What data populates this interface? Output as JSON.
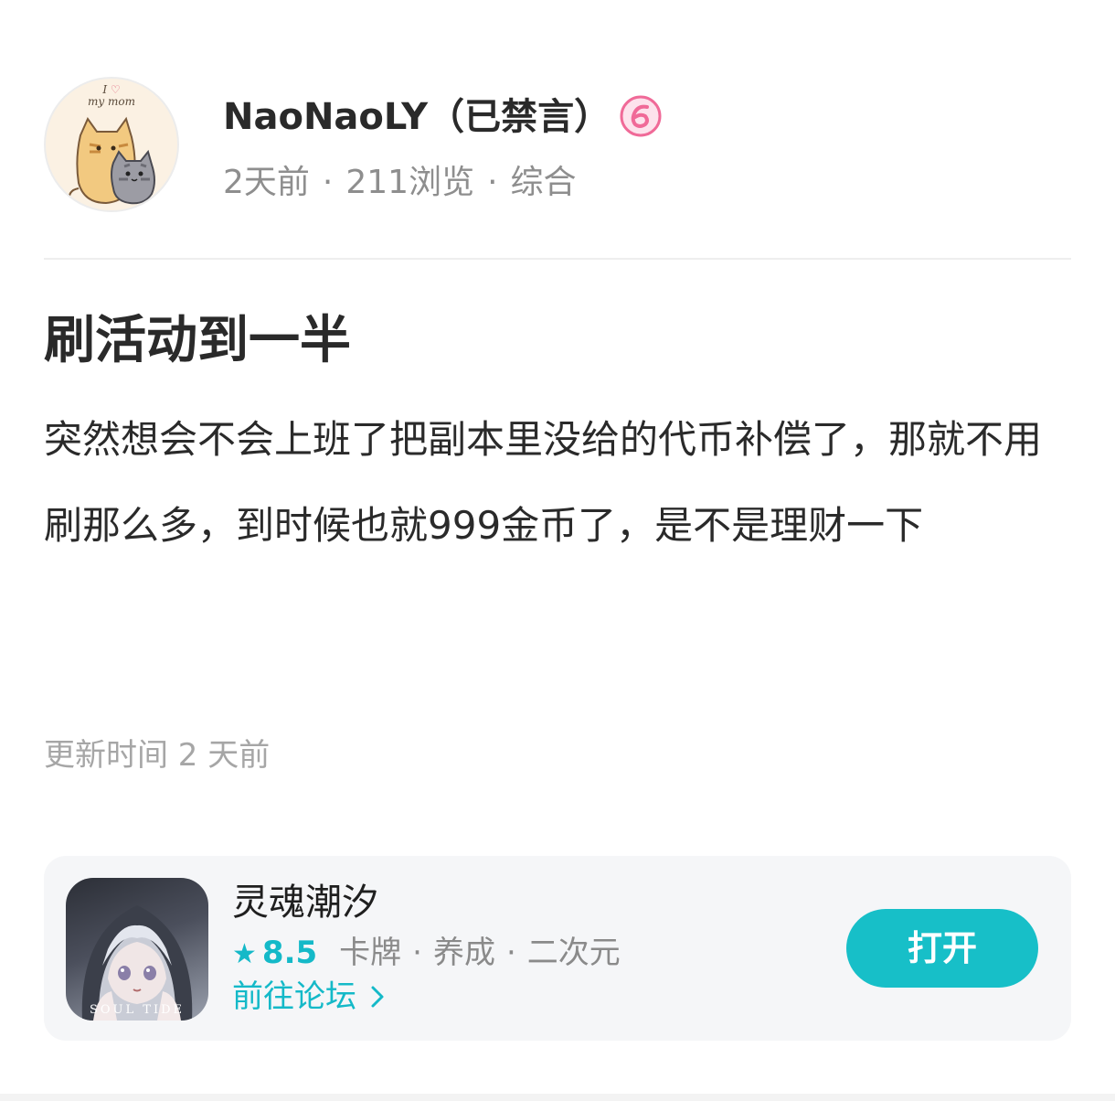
{
  "author": {
    "avatar_caption_top": "I",
    "avatar_caption_bottom": "my mom",
    "name": "NaoNaoLY（已禁言）",
    "level_icon": "level-6-badge-icon",
    "time": "2天前",
    "views": "211浏览",
    "category": "综合",
    "separator": "·"
  },
  "post": {
    "title": "刷活动到一半",
    "body": "突然想会不会上班了把副本里没给的代币补偿了，那就不用刷那么多，到时候也就999金币了，是不是理财一下",
    "updated": "更新时间 2 天前"
  },
  "app_card": {
    "name": "灵魂潮汐",
    "icon_text": "SOUL TIDE",
    "rating_icon": "star-icon",
    "rating": "8.5",
    "tags": [
      "卡牌",
      "养成",
      "二次元"
    ],
    "separator": "·",
    "forum_link": "前往论坛",
    "open_label": "打开"
  },
  "colors": {
    "accent": "#17bfc8",
    "meta_text": "#8e8e8e",
    "card_bg": "#f5f6f8",
    "badge_pink": "#f06a98"
  }
}
